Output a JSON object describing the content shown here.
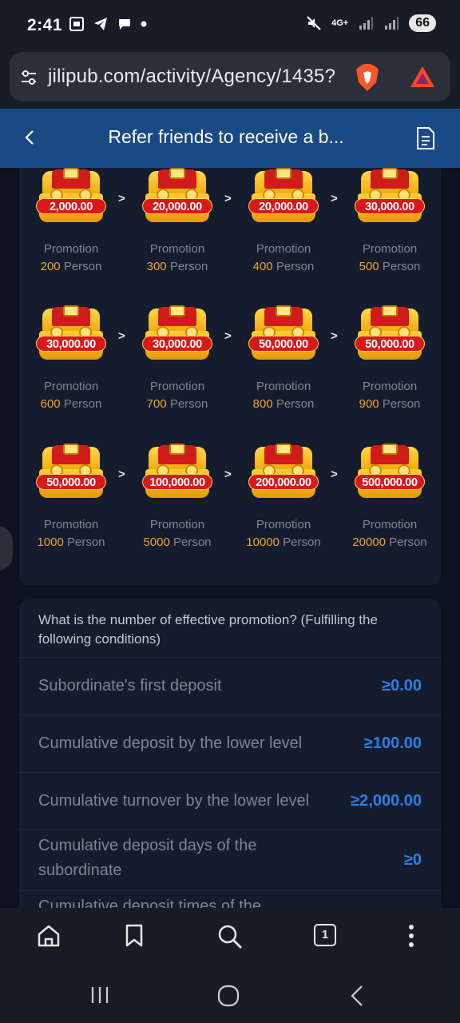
{
  "status_bar": {
    "time": "2:41",
    "battery": "66",
    "network": "4G+"
  },
  "browser": {
    "url": "jilipub.com/activity/Agency/1435?"
  },
  "app_bar": {
    "title": "Refer friends to receive a b..."
  },
  "tiers": [
    {
      "amount": "2,000.00",
      "label": "Promotion",
      "count": "200",
      "unit": "Person"
    },
    {
      "amount": "20,000.00",
      "label": "Promotion",
      "count": "300",
      "unit": "Person"
    },
    {
      "amount": "20,000.00",
      "label": "Promotion",
      "count": "400",
      "unit": "Person"
    },
    {
      "amount": "30,000.00",
      "label": "Promotion",
      "count": "500",
      "unit": "Person"
    },
    {
      "amount": "30,000.00",
      "label": "Promotion",
      "count": "600",
      "unit": "Person"
    },
    {
      "amount": "30,000.00",
      "label": "Promotion",
      "count": "700",
      "unit": "Person"
    },
    {
      "amount": "50,000.00",
      "label": "Promotion",
      "count": "800",
      "unit": "Person"
    },
    {
      "amount": "50,000.00",
      "label": "Promotion",
      "count": "900",
      "unit": "Person"
    },
    {
      "amount": "50,000.00",
      "label": "Promotion",
      "count": "1000",
      "unit": "Person"
    },
    {
      "amount": "100,000.00",
      "label": "Promotion",
      "count": "5000",
      "unit": "Person"
    },
    {
      "amount": "200,000.00",
      "label": "Promotion",
      "count": "10000",
      "unit": "Person"
    },
    {
      "amount": "500,000.00",
      "label": "Promotion",
      "count": "20000",
      "unit": "Person"
    }
  ],
  "arrow_symbol": ">",
  "conditions": {
    "question": "What is the number of effective promotion? (Fulfilling the following conditions)",
    "items": [
      {
        "label": "Subordinate's first deposit",
        "value": "≥0.00"
      },
      {
        "label": "Cumulative deposit by the lower level",
        "value": "≥100.00"
      },
      {
        "label": "Cumulative turnover by the lower level",
        "value": "≥2,000.00"
      },
      {
        "label": "Cumulative deposit days of the subordinate",
        "value": "≥0"
      },
      {
        "label": "Cumulative deposit times of the",
        "value": ""
      }
    ]
  },
  "browser_nav": {
    "tab_count": "1"
  },
  "colors": {
    "accent_blue": "#2d7ee6",
    "count_orange": "#f0a52a",
    "header_blue": "#1a4a86"
  }
}
